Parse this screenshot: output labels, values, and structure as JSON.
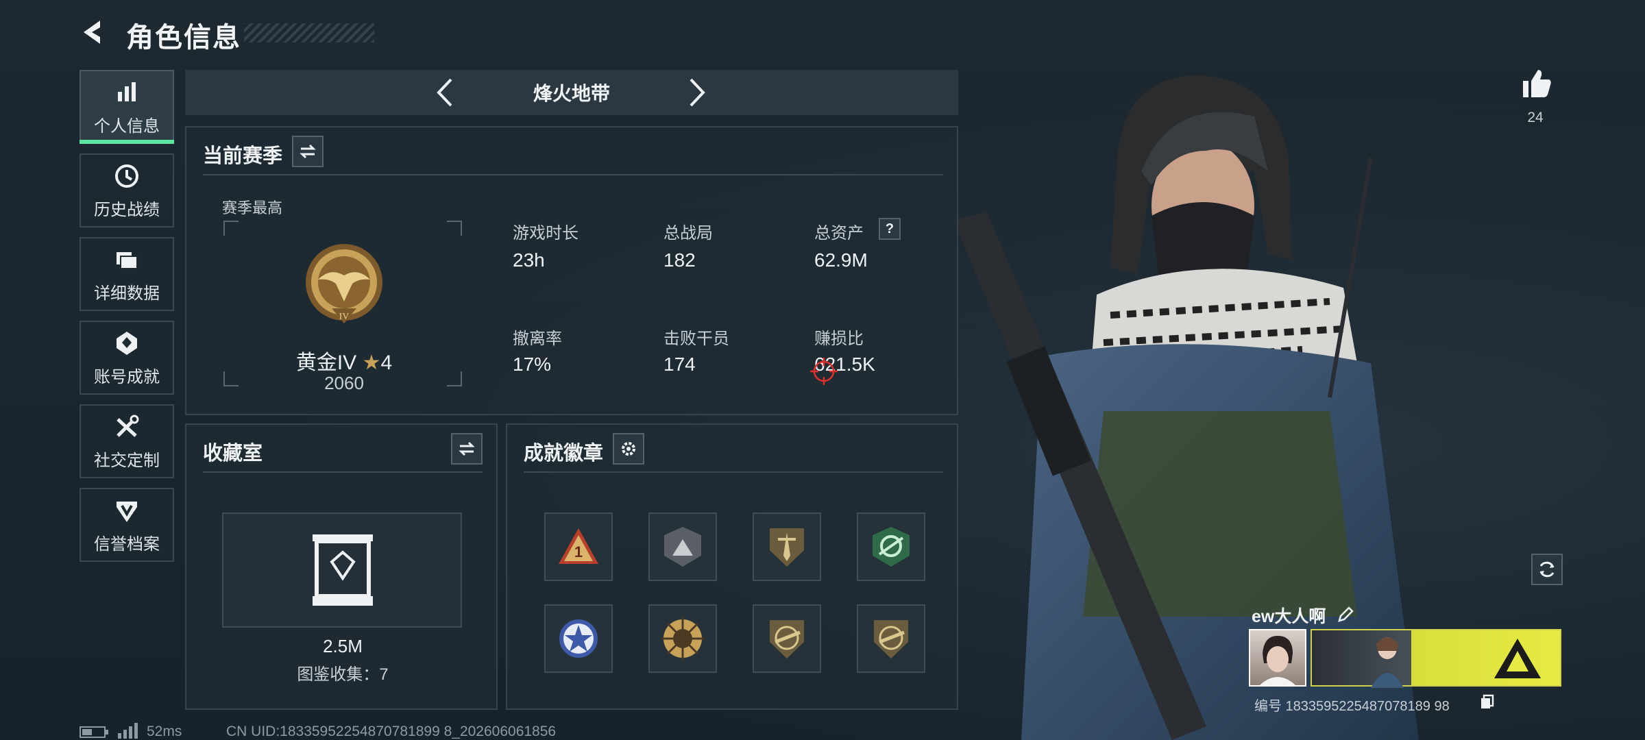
{
  "header": {
    "title": "角色信息"
  },
  "sidebar": {
    "items": [
      {
        "label": "个人信息",
        "icon": "bar-chart-icon",
        "active": true
      },
      {
        "label": "历史战绩",
        "icon": "clock-history-icon"
      },
      {
        "label": "详细数据",
        "icon": "folder-icon"
      },
      {
        "label": "账号成就",
        "icon": "achievement-icon"
      },
      {
        "label": "社交定制",
        "icon": "tools-icon"
      },
      {
        "label": "信誉档案",
        "icon": "shield-credit-icon"
      }
    ]
  },
  "mode_selector": {
    "title": "烽火地带"
  },
  "season": {
    "title": "当前赛季",
    "best_label": "赛季最高",
    "rank_name": "黄金IV",
    "rank_stars": "4",
    "rank_score": "2060",
    "stats": [
      {
        "label": "游戏时长",
        "value": "23h"
      },
      {
        "label": "总战局",
        "value": "182"
      },
      {
        "label": "总资产",
        "value": "62.9M",
        "help": "?"
      },
      {
        "label": "撤离率",
        "value": "17%"
      },
      {
        "label": "击败干员",
        "value": "174"
      },
      {
        "label": "赚损比",
        "value": "621.5K"
      }
    ]
  },
  "collection": {
    "title": "收藏室",
    "value": "2.5M",
    "caption": "图鉴收集：7"
  },
  "achievements": {
    "title": "成就徽章",
    "badges": [
      "triangle-1-badge-icon",
      "mountain-badge-icon",
      "dagger-badge-icon",
      "green-wings-badge-icon",
      "blue-star-badge-icon",
      "sunburst-badge-icon",
      "rifle-badge-icon",
      "rifle-badge-icon-2"
    ]
  },
  "likes": {
    "count": "24"
  },
  "player": {
    "name": "ew大人啊",
    "id_line": "编号 1833595225487078189 98"
  },
  "footer": {
    "ping": "52ms",
    "uid": "CN UID:18335952254870781899 8_202606061856"
  },
  "colors": {
    "accent": "#5ee6a0",
    "gold": "#c9a25a",
    "aim": "#e0302a"
  }
}
